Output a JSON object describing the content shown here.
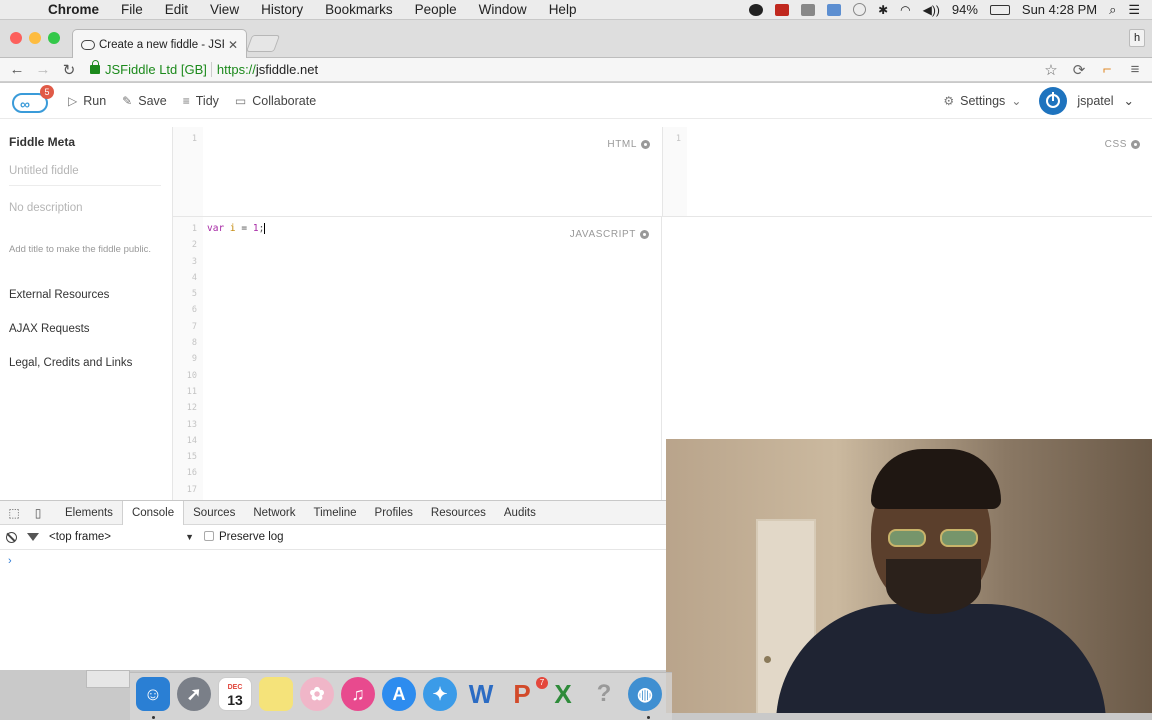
{
  "menubar": {
    "app": "Chrome",
    "items": [
      "File",
      "Edit",
      "View",
      "History",
      "Bookmarks",
      "People",
      "Window",
      "Help"
    ],
    "battery": "94%",
    "clock": "Sun 4:28 PM"
  },
  "browser": {
    "tab_title": "Create a new fiddle - JSFiddle",
    "profile_letter": "h",
    "ev_org": "JSFiddle Ltd [GB]",
    "url_scheme": "https://",
    "url_host": "jsfiddle.net"
  },
  "jsfiddle": {
    "logo_badge": "5",
    "actions": {
      "run": "Run",
      "save": "Save",
      "tidy": "Tidy",
      "collaborate": "Collaborate"
    },
    "settings": "Settings",
    "username": "jspatel"
  },
  "sidebar": {
    "title": "Fiddle Meta",
    "title_placeholder": "Untitled fiddle",
    "description_placeholder": "No description",
    "hint": "Add title to make the fiddle public.",
    "links": [
      "External Resources",
      "AJAX Requests",
      "Legal, Credits and Links"
    ]
  },
  "panels": {
    "html_label": "HTML",
    "css_label": "CSS",
    "js_label": "JAVASCRIPT",
    "html_lines": [
      "1"
    ],
    "css_lines": [
      "1"
    ],
    "js_lines": [
      "1",
      "2",
      "3",
      "4",
      "5",
      "6",
      "7",
      "8",
      "9",
      "10",
      "11",
      "12",
      "13",
      "14",
      "15",
      "16",
      "17"
    ],
    "js_code": {
      "keyword": "var",
      "name": "i",
      "operator": "=",
      "value": "1",
      "end": ";"
    }
  },
  "devtools": {
    "tabs": [
      "Elements",
      "Console",
      "Sources",
      "Network",
      "Timeline",
      "Profiles",
      "Resources",
      "Audits"
    ],
    "active_tab": "Console",
    "frame": "<top frame>",
    "preserve_log": "Preserve log",
    "prompt": "›"
  },
  "dock": {
    "calendar_month": "DEC",
    "calendar_day": "13",
    "appstore_badge": "7"
  },
  "colors": {
    "accent": "#3a9bd9",
    "ev_green": "#1c8a1c",
    "badge_red": "#e05a47"
  }
}
